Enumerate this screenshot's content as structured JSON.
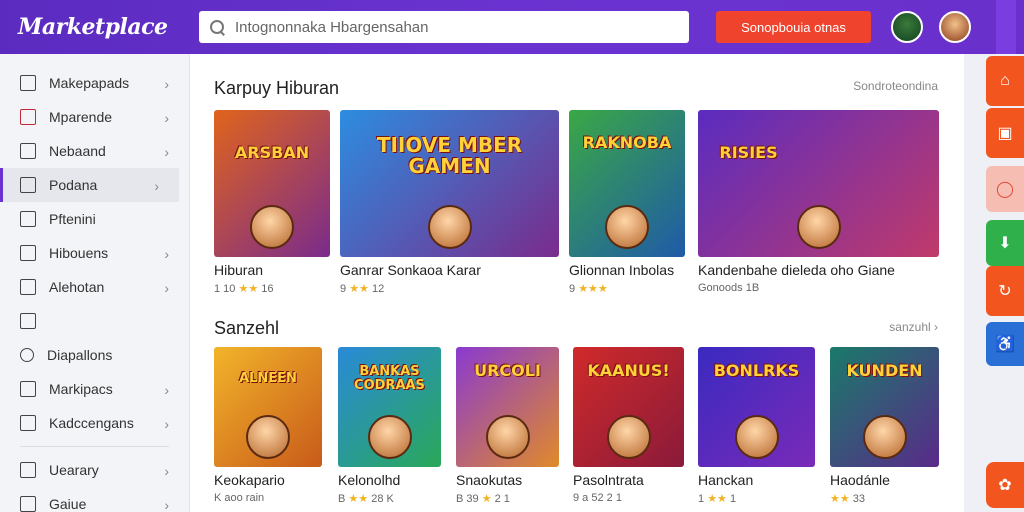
{
  "brand": {
    "logo": "Marketplace"
  },
  "search": {
    "placeholder": "Intognonnaka Hbargensahan"
  },
  "header": {
    "cta_label": "Sonopbouia otnas"
  },
  "sidebar": {
    "items": [
      {
        "label": "Makepapads",
        "icon": "home-icon",
        "chevron": "›"
      },
      {
        "label": "Mparende",
        "icon": "checkbox-icon",
        "chevron": "›"
      },
      {
        "label": "Nebaand",
        "icon": "square-icon",
        "chevron": "›"
      },
      {
        "label": "Podana",
        "icon": "list-icon",
        "chevron": "›"
      },
      {
        "label": "Pftenini",
        "icon": "tag-icon",
        "chevron": ""
      },
      {
        "label": "Hibouens",
        "icon": "grid-icon",
        "chevron": "›"
      },
      {
        "label": "Alehotan",
        "icon": "flag-icon",
        "chevron": "›"
      },
      {
        "label": "",
        "icon": "document-icon",
        "chevron": ""
      },
      {
        "label": "Diapallons",
        "icon": "search-icon",
        "chevron": ""
      },
      {
        "label": "Markipacs",
        "icon": "bookmark-icon",
        "chevron": "›"
      },
      {
        "label": "Kadccengans",
        "icon": "pencil-icon",
        "chevron": "›"
      },
      {
        "label": "Uearary",
        "icon": "home-icon",
        "chevron": "›"
      },
      {
        "label": "Gaiue",
        "icon": "gift-icon",
        "chevron": "›"
      }
    ]
  },
  "sections": [
    {
      "title": "Karpuy Hiburan",
      "link": "Sondroteondina",
      "cards": [
        {
          "title": "Hiburan",
          "meta": "1 10 ★★ 16",
          "art": "ARSBAN",
          "colors": [
            "#e0641c",
            "#7a2b8c"
          ]
        },
        {
          "title": "Ganrar Sonkaoa Karar",
          "meta": "9 ★★ 12",
          "art": "TIIOVE MBER GAMEN",
          "colors": [
            "#2c8de0",
            "#7a2b8c"
          ]
        },
        {
          "title": "Glionnan Inbolas",
          "meta": "9 ★★★",
          "art": "RAKNOBA",
          "colors": [
            "#3aa845",
            "#1f5aa8"
          ]
        },
        {
          "title": "Kandenbahe dieleda oho Giane",
          "meta": "Gonoods 1B",
          "art": "RISIES",
          "colors": [
            "#5a2cc0",
            "#c03a6a"
          ]
        }
      ]
    },
    {
      "title": "Sanzehl",
      "link": "sanzuhl ›",
      "cards": [
        {
          "title": "Keokapario",
          "meta": "K aoo rain",
          "art": "ALNEEN",
          "colors": [
            "#f2b42a",
            "#c85a1a"
          ]
        },
        {
          "title": "Kelonolhd",
          "meta": "B ★★ 28 K",
          "art": "BANKAS CODRAAS",
          "colors": [
            "#2a8ad8",
            "#2aa858"
          ]
        },
        {
          "title": "Snaokutas",
          "meta": "B 39 ★ 2 1",
          "art": "URCOLI",
          "colors": [
            "#8a3ad0",
            "#e08a2a"
          ]
        },
        {
          "title": "Pasolntrata",
          "meta": "9 a 52 2 1",
          "art": "KAANUS!",
          "colors": [
            "#d02a2a",
            "#8a1a3a"
          ]
        },
        {
          "title": "Hanckan",
          "meta": "1 ★★ 1",
          "art": "BONLRKS",
          "colors": [
            "#3a2ac0",
            "#7a2ab8"
          ]
        },
        {
          "title": "Haodánle",
          "meta": "★★ 33",
          "art": "KUNDEN",
          "colors": [
            "#1a7a6a",
            "#5a2a8a"
          ]
        }
      ]
    }
  ],
  "rail": [
    {
      "icon": "home-icon",
      "color": "#f2551e"
    },
    {
      "icon": "gift-icon",
      "color": "#f2551e"
    },
    {
      "icon": "chat-icon",
      "color": "#f6bdb2"
    },
    {
      "icon": "download-icon",
      "color": "#2fb04a"
    },
    {
      "icon": "refresh-icon",
      "color": "#f2551e"
    },
    {
      "icon": "accessibility-icon",
      "color": "#2a6fd6"
    },
    {
      "icon": "settings-icon",
      "color": "#f2551e"
    }
  ]
}
